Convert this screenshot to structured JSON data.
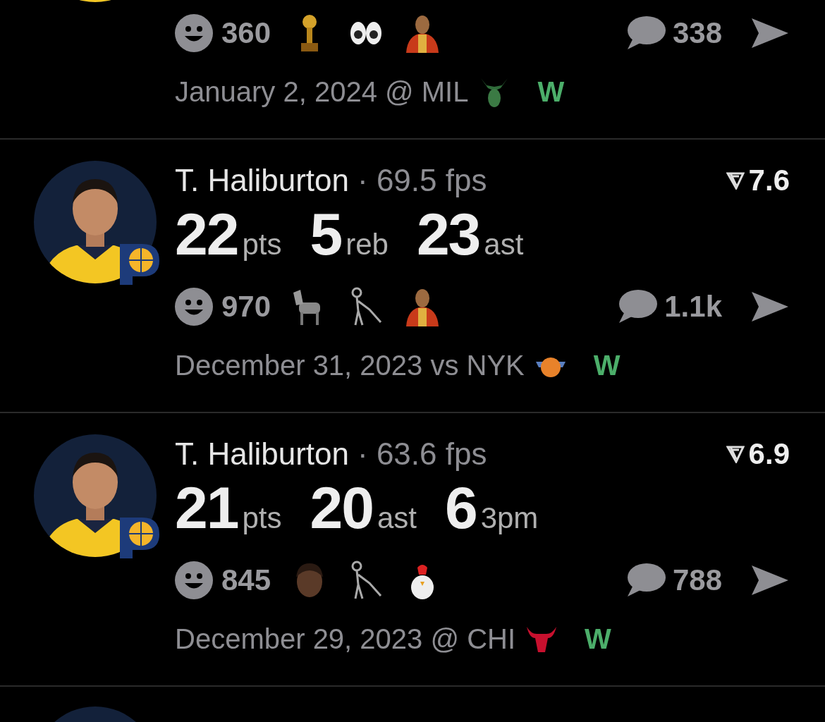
{
  "posts": [
    {
      "kind": "cut-top",
      "reactions": {
        "count": "360",
        "emojis": [
          {
            "kind": "trophy"
          },
          {
            "kind": "eyes"
          },
          {
            "kind": "person"
          }
        ]
      },
      "comments": "338",
      "date": "January 2, 2024 @ MIL",
      "opponent": {
        "kind": "deer"
      },
      "result": {
        "text": "W",
        "won": true
      }
    },
    {
      "kind": "full",
      "player": "T. Haliburton",
      "fps": "· 69.5 fps",
      "rating": "7.6",
      "stats": [
        {
          "value": "22",
          "unit": "pts"
        },
        {
          "value": "5",
          "unit": "reb"
        },
        {
          "value": "23",
          "unit": "ast"
        }
      ],
      "reactions": {
        "count": "970",
        "emojis": [
          {
            "kind": "goat"
          },
          {
            "kind": "skeleton"
          },
          {
            "kind": "person"
          }
        ]
      },
      "comments": "1.1k",
      "date": "December 31, 2023 vs NYK",
      "opponent": {
        "kind": "ball"
      },
      "result": {
        "text": "W",
        "won": true
      }
    },
    {
      "kind": "full",
      "player": "T. Haliburton",
      "fps": "· 63.6 fps",
      "rating": "6.9",
      "stats": [
        {
          "value": "21",
          "unit": "pts"
        },
        {
          "value": "20",
          "unit": "ast"
        },
        {
          "value": "6",
          "unit": "3pm"
        }
      ],
      "reactions": {
        "count": "845",
        "emojis": [
          {
            "kind": "head"
          },
          {
            "kind": "skeleton"
          },
          {
            "kind": "chicken"
          }
        ]
      },
      "comments": "788",
      "date": "December 29, 2023 @ CHI",
      "opponent": {
        "kind": "bull"
      },
      "result": {
        "text": "W",
        "won": true
      }
    },
    {
      "kind": "cut-bottom"
    }
  ]
}
